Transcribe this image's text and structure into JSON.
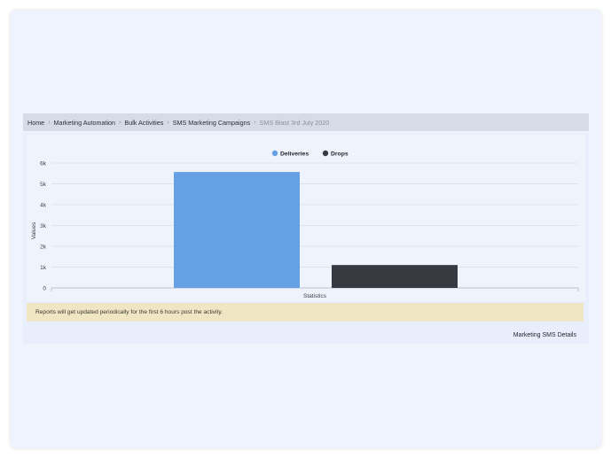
{
  "breadcrumb": [
    "Home",
    "Marketing Automation",
    "Bulk Activities",
    "SMS Marketing Campaigns",
    "SMS Blast 3rd July 2020"
  ],
  "chart_data": {
    "type": "bar",
    "categories": [
      "Statistics"
    ],
    "series": [
      {
        "name": "Deliveries",
        "values": [
          5570
        ],
        "color": "#66a1e5"
      },
      {
        "name": "Drops",
        "values": [
          1100
        ],
        "color": "#383a42"
      }
    ],
    "xlabel": "Statistics",
    "ylabel": "Values",
    "ylim": [
      0,
      6000
    ],
    "yticks": [
      0,
      1000,
      2000,
      3000,
      4000,
      5000,
      6000
    ],
    "ytick_labels": [
      "0",
      "1k",
      "2k",
      "3k",
      "4k",
      "5k",
      "6k"
    ],
    "grid": true,
    "legend": "top-center"
  },
  "notice": "Reports will get updated periodically for the first 6 hours post the activity.",
  "footer_link": "Marketing SMS Details"
}
